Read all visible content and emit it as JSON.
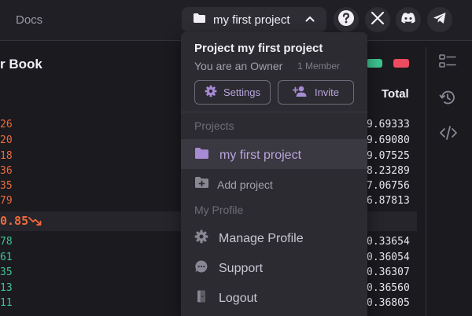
{
  "topbar": {
    "docs_label": "Docs",
    "project_switch_label": "my first project",
    "icons": [
      "help-icon",
      "x-icon",
      "discord-icon",
      "telegram-icon"
    ]
  },
  "book": {
    "title": "r Book",
    "total_header": "Total",
    "toggle_colors": [
      "#3ec490",
      "#ef4b5f"
    ],
    "left_prices_top": [
      "26",
      "20",
      "18",
      "36",
      "35",
      "79"
    ],
    "left_prices_bottom": [
      "78",
      "61",
      "35",
      "13",
      "11"
    ],
    "mid_price": "0.85",
    "totals_top": [
      "9.69333",
      "9.69080",
      "9.07525",
      "8.23289",
      "7.06756",
      "6.87813"
    ],
    "totals_bottom": [
      "0.33654",
      "0.36054",
      "0.36307",
      "0.36560",
      "0.36805"
    ]
  },
  "dropdown": {
    "project_title": "Project my first project",
    "role_text": "You are an Owner",
    "member_count": "1 Member",
    "settings_label": "Settings",
    "invite_label": "Invite",
    "projects_section": "Projects",
    "active_project": "my first project",
    "add_project": "Add project",
    "profile_section": "My Profile",
    "manage_profile": "Manage Profile",
    "support": "Support",
    "logout": "Logout"
  },
  "colors": {
    "accent": "#a78bd4",
    "ask": "#ef6a3a",
    "bid": "#3ec490"
  }
}
